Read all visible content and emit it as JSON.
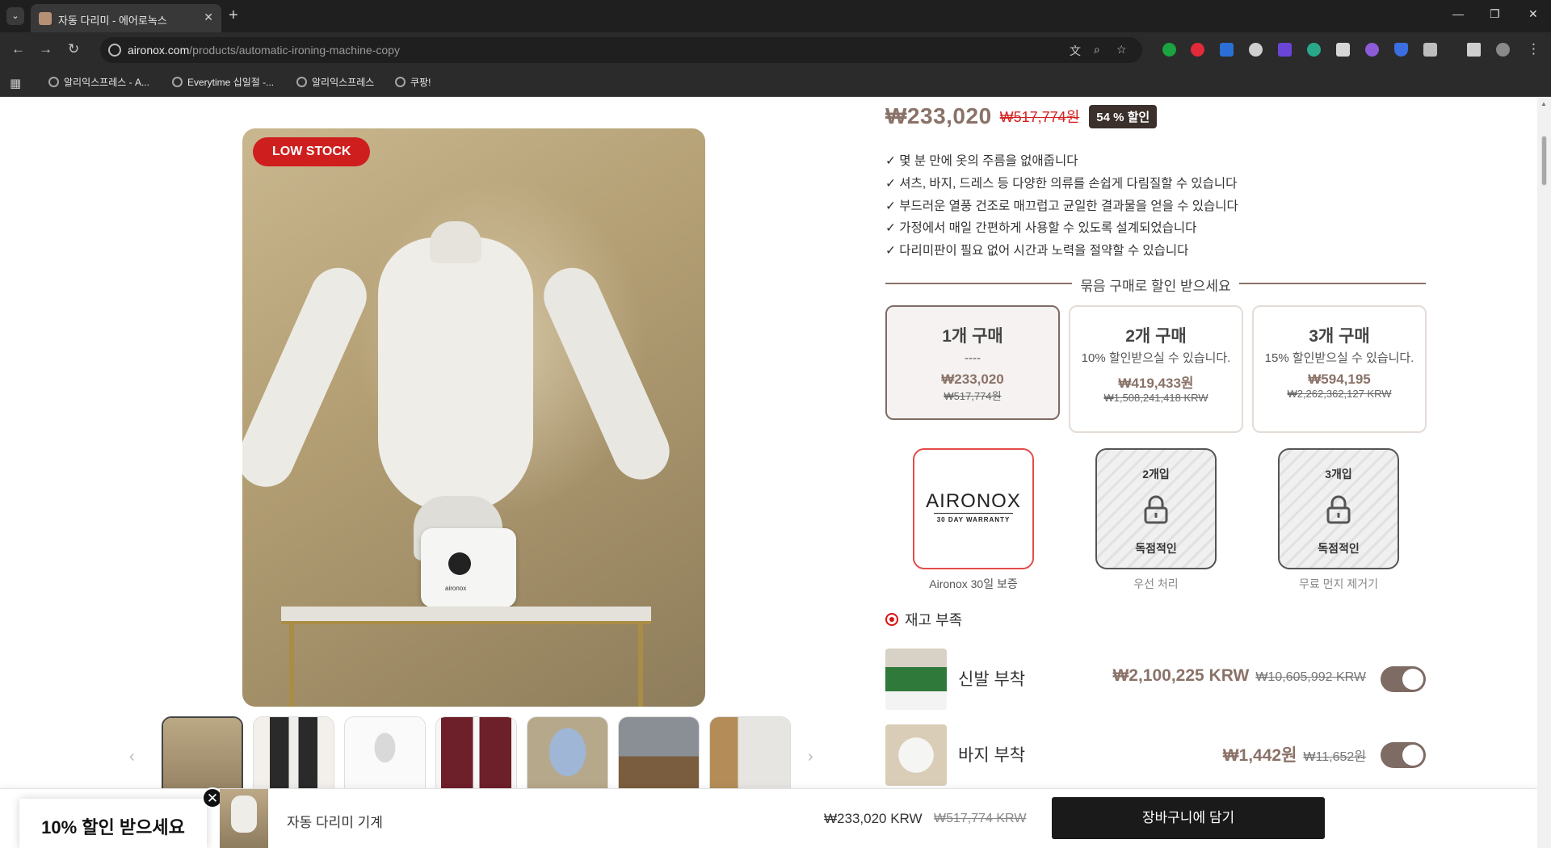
{
  "browser": {
    "tab_title": "자동 다리미 - 에어로녹스",
    "tab_close": "✕",
    "new_tab": "+",
    "url_domain": "aironox.com",
    "url_path": "/products/automatic-ironing-machine-copy",
    "bookmarks": [
      "알리익스프레스 - A...",
      "Everytime 십일절 -...",
      "알리익스프레스",
      "쿠팡!"
    ],
    "window_controls": [
      "—",
      "❐",
      "✕"
    ]
  },
  "product": {
    "price": "₩233,020",
    "old_price": "₩517,774원",
    "discount_badge": "54 % 할인",
    "low_stock_badge": "LOW STOCK",
    "features": [
      "✓ 몇 분 만에 옷의 주름을 없애줍니다",
      "✓ 셔츠, 바지, 드레스 등 다양한 의류를 손쉽게 다림질할 수 있습니다",
      "✓ 부드러운 열풍 건조로 매끄럽고 균일한 결과물을 얻을 수 있습니다",
      "✓ 가정에서 매일 간편하게 사용할 수 있도록 설계되었습니다",
      "✓ 다리미판이 필요 없어 시간과 노력을 절약할 수 있습니다"
    ],
    "bundle_heading": "묶음 구매로 할인 받으세요",
    "bundles": [
      {
        "title": "1개 구매",
        "sub": "----",
        "price": "₩233,020",
        "old": "₩517,774원"
      },
      {
        "title": "2개 구매",
        "sub": "10% 할인받으실 수 있습니다.",
        "price": "₩419,433원",
        "old": "₩1,508,241,418 KRW"
      },
      {
        "title": "3개 구매",
        "sub": "15% 할인받으실 수 있습니다.",
        "price": "₩594,195",
        "old": "₩2,262,362,127 KRW"
      }
    ],
    "gifts": [
      {
        "logo": "AIRONOX",
        "logo_sub": "30 DAY WARRANTY",
        "caption": "Aironox 30일 보증"
      },
      {
        "top": "2개입",
        "bottom": "독점적인",
        "caption": "우선 처리"
      },
      {
        "top": "3개입",
        "bottom": "독점적인",
        "caption": "무료 먼지 제거기"
      }
    ],
    "stock_status": "재고 부족",
    "addons": [
      {
        "name": "신발 부착",
        "price": "₩2,100,225 KRW",
        "old_price": "₩10,605,992 KRW",
        "enabled": true
      },
      {
        "name": "바지 부착",
        "price": "₩1,442원",
        "old_price": "₩11,652원",
        "enabled": true
      }
    ]
  },
  "sticky_bar": {
    "promo": "10% 할인 받으세요",
    "promo_close": "✕",
    "product_name": "자동 다리미 기계",
    "price": "₩233,020 KRW",
    "old_price": "₩517,774 KRW",
    "cart_button": "장바구니에 담기"
  },
  "gallery": {
    "prev": "‹",
    "next": "›",
    "thumbnail_count": 7
  },
  "colors": {
    "accent": "#8a7268",
    "sale_red": "#d32020",
    "badge_dark": "#3b302b",
    "low_stock_red": "#cf1e1e"
  }
}
